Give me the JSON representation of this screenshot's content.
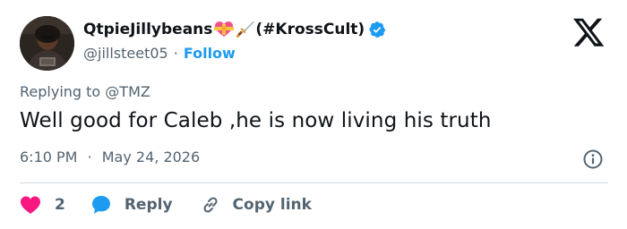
{
  "author": {
    "display_name": "QtpieJillybeans",
    "display_name_suffix": "(#KrossCult)",
    "emoji_1": "heart-with-ribbon-icon",
    "emoji_2": "dagger-icon",
    "handle": "@jillsteet05",
    "separator": "·",
    "follow_label": "Follow"
  },
  "reply_context": {
    "prefix": "Replying to",
    "mention": "@TMZ"
  },
  "tweet": {
    "text": "Well good for Caleb ,he is now living his truth",
    "time": "6:10 PM",
    "separator": "·",
    "date": "May 24, 2026"
  },
  "actions": {
    "like_count": "2",
    "reply_label": "Reply",
    "copy_link_label": "Copy link"
  },
  "colors": {
    "like": "#f91880",
    "reply": "#1d9bf0",
    "follow": "#1d9bf0",
    "verified": "#1d9bf0",
    "secondary_text": "#536471"
  }
}
